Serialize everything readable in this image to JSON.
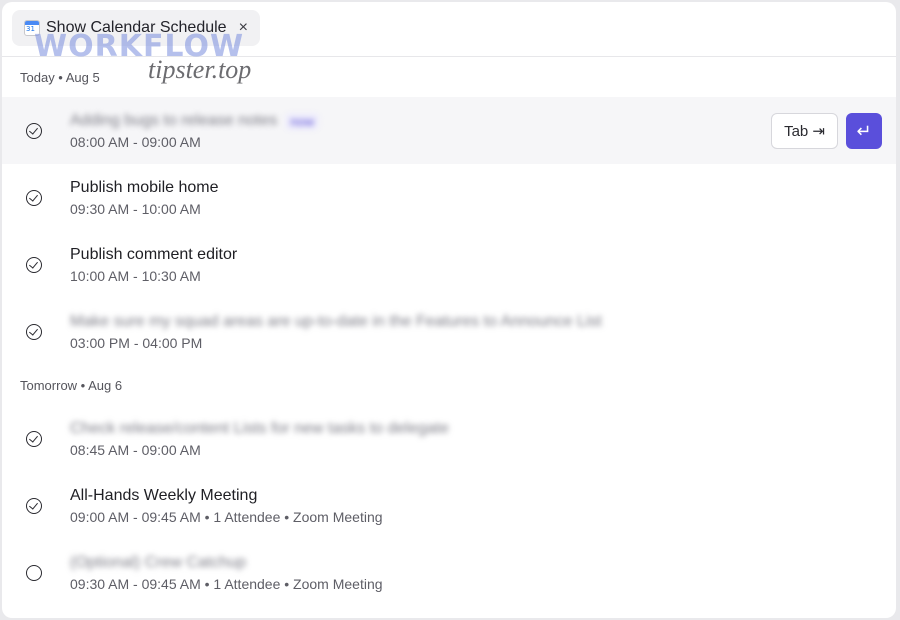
{
  "tab": {
    "title": "Show Calendar Schedule",
    "close_icon": "×"
  },
  "watermark": {
    "top": "WORKFLOW",
    "bottom": "tipster.top"
  },
  "sections": [
    {
      "label": "Today • Aug 5",
      "events": [
        {
          "title": "Adding bugs to release notes",
          "time": "08:00 AM - 09:00 AM",
          "done": true,
          "blurred": true,
          "badge": "now",
          "selected": true
        },
        {
          "title": "Publish mobile home",
          "time": "09:30 AM - 10:00 AM",
          "done": true,
          "blurred": false
        },
        {
          "title": "Publish comment editor",
          "time": "10:00 AM - 10:30 AM",
          "done": true,
          "blurred": false
        },
        {
          "title": "Make sure my squad areas are up-to-date in the Features to Announce List",
          "time": "03:00 PM - 04:00 PM",
          "done": true,
          "blurred": true
        }
      ]
    },
    {
      "label": "Tomorrow • Aug 6",
      "events": [
        {
          "title": "Check release/content Lists for new tasks to delegate",
          "time": "08:45 AM - 09:00 AM",
          "done": true,
          "blurred": true
        },
        {
          "title": "All-Hands Weekly Meeting",
          "time": "09:00 AM - 09:45 AM • 1 Attendee • Zoom Meeting",
          "done": true,
          "blurred": false
        },
        {
          "title": "(Optional) Crew Catchup",
          "time": "09:30 AM - 09:45 AM • 1 Attendee • Zoom Meeting",
          "done": false,
          "blurred": true
        }
      ]
    }
  ],
  "actions": {
    "tab_label": "Tab ⇥",
    "enter_icon": "↵"
  }
}
